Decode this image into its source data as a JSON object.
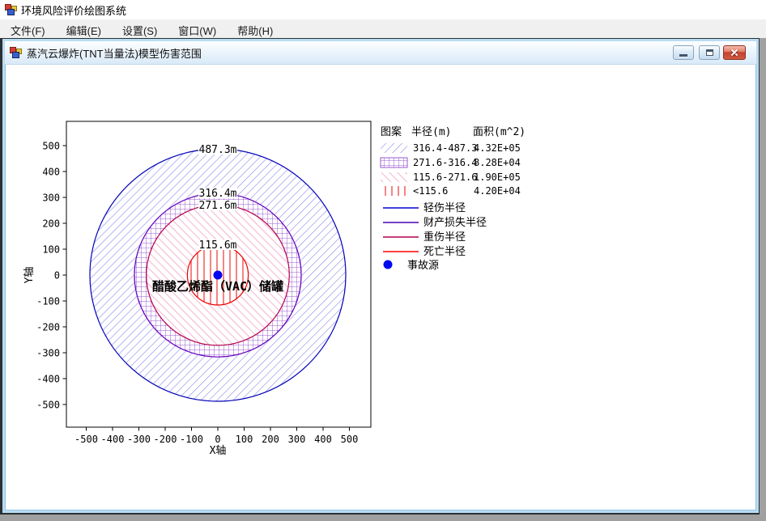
{
  "window": {
    "title": "环境风险评价绘图系统"
  },
  "menu": {
    "items": [
      {
        "label": "文件(F)"
      },
      {
        "label": "编辑(E)"
      },
      {
        "label": "设置(S)"
      },
      {
        "label": "窗口(W)"
      },
      {
        "label": "帮助(H)"
      }
    ]
  },
  "child": {
    "title": "蒸汽云爆炸(TNT当量法)模型伤害范围"
  },
  "chart_data": {
    "type": "area",
    "title": "蒸汽云爆炸(TNT当量法)模型伤害范围",
    "xlabel": "X轴",
    "ylabel": "Y轴",
    "xlim": [
      -580,
      580
    ],
    "ylim": [
      -590,
      590
    ],
    "grid": false,
    "legend_position": "right",
    "x_ticks": [
      "-500",
      "-400",
      "-300",
      "-200",
      "-100",
      "0",
      "100",
      "200",
      "300",
      "400",
      "500"
    ],
    "y_ticks": [
      "500",
      "400",
      "300",
      "200",
      "100",
      "0",
      "-100",
      "-200",
      "-300",
      "-400",
      "-500"
    ],
    "center_label": "醋酸乙烯酯（VAC）储罐",
    "source_point": {
      "x": 0,
      "y": 0,
      "label": "事故源",
      "color": "#0008f0"
    },
    "rings": [
      {
        "label": "487.3m",
        "radius_m": 487.3,
        "range_m": "316.4-487.3",
        "area_m2": "4.32E+05",
        "meaning": "轻伤半径",
        "pattern": "diagonal-forward-hatch",
        "pattern_color": "#9090f2",
        "outline_color": "#0000b8"
      },
      {
        "label": "316.4m",
        "radius_m": 316.4,
        "range_m": "271.6-316.4",
        "area_m2": "8.28E+04",
        "meaning": "财产损失半径",
        "pattern": "square-grid",
        "pattern_color": "#9a5ad2",
        "outline_color": "#6400be"
      },
      {
        "label": "271.6m",
        "radius_m": 271.6,
        "range_m": "115.6-271.6",
        "area_m2": "1.90E+05",
        "meaning": "重伤半径",
        "pattern": "diagonal-back-hatch",
        "pattern_color": "#f08cb4",
        "outline_color": "#b4004b"
      },
      {
        "label": "115.6m",
        "radius_m": 115.6,
        "range_m": "<115.6",
        "area_m2": "4.20E+04",
        "meaning": "死亡半径",
        "pattern": "vertical-hatch",
        "pattern_color": "#f24040",
        "outline_color": "#ee0000"
      }
    ],
    "legend": {
      "headers": {
        "pattern": "图案",
        "radius": "半径(m)",
        "area": "面积(m^2)"
      },
      "lines": [
        {
          "label": "轻伤半径",
          "color": "#0000d0"
        },
        {
          "label": "财产损失半径",
          "color": "#4a00b4"
        },
        {
          "label": "重伤半径",
          "color": "#b4004b"
        },
        {
          "label": "死亡半径",
          "color": "#ff0000"
        }
      ],
      "source": {
        "label": "事故源",
        "color": "#0008f0"
      }
    }
  }
}
